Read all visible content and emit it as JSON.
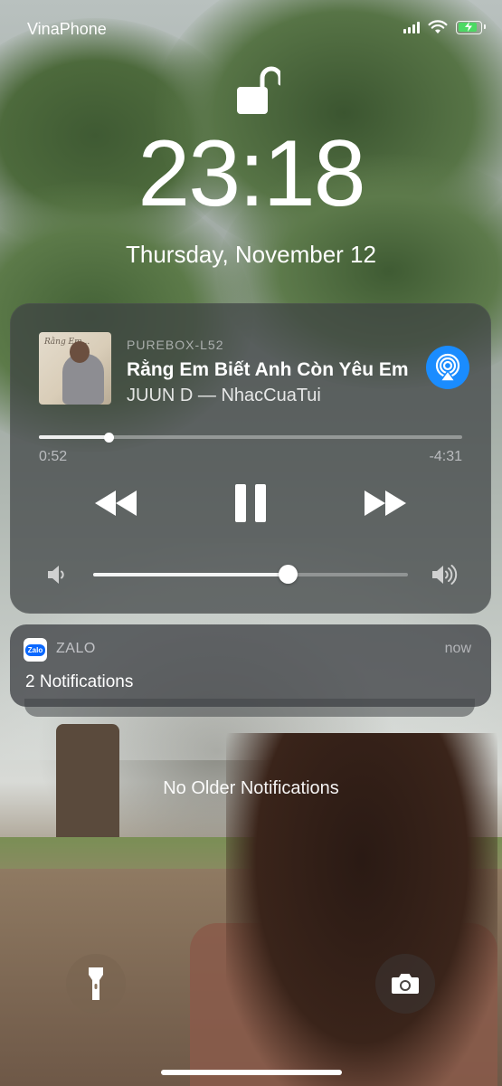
{
  "status_bar": {
    "carrier": "VinaPhone",
    "signal_bars_filled": 4,
    "wifi": "wifi-icon",
    "battery_charging": true,
    "battery_color": "#4cd964"
  },
  "lock_screen": {
    "lock_icon": "unlocked-padlock-icon",
    "time": "23:18",
    "date": "Thursday, November 12"
  },
  "now_playing": {
    "device": "PUREBOX-L52",
    "title": "Rằng Em Biết Anh Còn Yêu Em",
    "artist_line": "JUUN D — NhacCuaTui",
    "airplay_icon": "airplay-icon",
    "airplay_color": "#1a8cff",
    "elapsed": "0:52",
    "remaining": "-4:31",
    "progress_fraction": 0.165,
    "volume_fraction": 0.62,
    "controls": [
      "rewind-icon",
      "pause-icon",
      "fast-forward-icon"
    ]
  },
  "notification": {
    "app_icon_text": "Zalo",
    "app_name": "ZALO",
    "time": "now",
    "body": "2 Notifications",
    "accent": "#0a68ff"
  },
  "no_older_text": "No Older Notifications",
  "bottom_buttons": [
    "flashlight-icon",
    "camera-icon"
  ]
}
